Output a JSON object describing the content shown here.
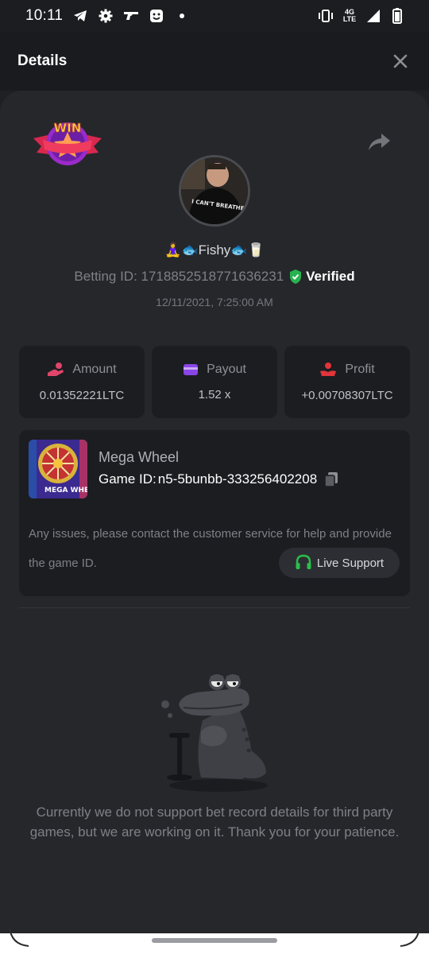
{
  "status_bar": {
    "time": "10:11",
    "left_icons": [
      "telegram-icon",
      "gear-icon",
      "gun-icon",
      "face-app-icon",
      "dot"
    ],
    "right_icons": [
      "vibrate-icon",
      "4g-lte-icon",
      "signal-icon",
      "battery-icon"
    ],
    "network": "4G",
    "network_sub": "LTE"
  },
  "header": {
    "title": "Details"
  },
  "profile": {
    "username": "🧘‍♀️🐟Fishy🐟🥛",
    "betting_id": "Betting ID: 1718852518771636231",
    "verified_label": "Verified",
    "timestamp": "12/11/2021, 7:25:00 AM",
    "win_badge_text": "WIN",
    "avatar_shirt_text": "I CAN'T BREATHE"
  },
  "stats": [
    {
      "label": "Amount",
      "value": "0.01352221LTC",
      "icon": "coins-hand-icon",
      "color": "#e0456a"
    },
    {
      "label": "Payout",
      "value": "1.52 x",
      "icon": "wallet-icon",
      "color": "#8a45e6"
    },
    {
      "label": "Profit",
      "value": "+0.00708307LTC",
      "icon": "profit-hand-icon",
      "color": "#e0353a"
    }
  ],
  "game": {
    "name": "Mega Wheel",
    "id_label": "Game ID:",
    "id_value": "n5-5bunbb-333256402208",
    "thumb_text": "MEGA WHEEL",
    "issue_text": "Any issues, please contact the customer service for help and provide the game ID.",
    "support_label": "Live Support"
  },
  "notice": "Currently we do not support bet record details for third party games, but we are working on it. Thank you for your patience.",
  "colors": {
    "background": "#1f2024",
    "sheet": "#26272b",
    "card": "#1c1d21",
    "verified_green": "#27b34f",
    "support_green": "#2bbf4a"
  }
}
